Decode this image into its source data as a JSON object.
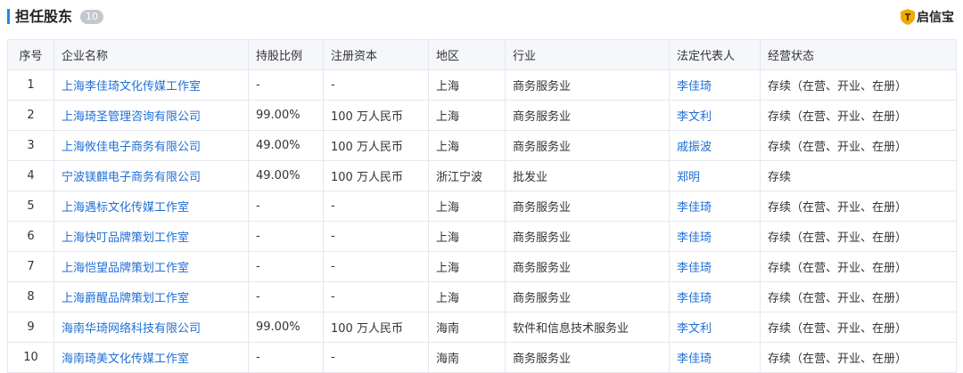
{
  "header": {
    "title": "担任股东",
    "count": "10",
    "brand": "启信宝"
  },
  "table": {
    "columns": [
      "序号",
      "企业名称",
      "持股比例",
      "注册资本",
      "地区",
      "行业",
      "法定代表人",
      "经营状态"
    ],
    "rows": [
      {
        "idx": "1",
        "name": "上海李佳琦文化传媒工作室",
        "ratio": "-",
        "capital": "-",
        "region": "上海",
        "industry": "商务服务业",
        "rep": "李佳琦",
        "status": "存续（在营、开业、在册）"
      },
      {
        "idx": "2",
        "name": "上海琦圣管理咨询有限公司",
        "ratio": "99.00%",
        "capital": "100 万人民币",
        "region": "上海",
        "industry": "商务服务业",
        "rep": "李文利",
        "status": "存续（在营、开业、在册）"
      },
      {
        "idx": "3",
        "name": "上海攸佳电子商务有限公司",
        "ratio": "49.00%",
        "capital": "100 万人民币",
        "region": "上海",
        "industry": "商务服务业",
        "rep": "戚振波",
        "status": "存续（在营、开业、在册）"
      },
      {
        "idx": "4",
        "name": "宁波镁麒电子商务有限公司",
        "ratio": "49.00%",
        "capital": "100 万人民币",
        "region": "浙江宁波",
        "industry": "批发业",
        "rep": "郑明",
        "status": "存续"
      },
      {
        "idx": "5",
        "name": "上海遇标文化传媒工作室",
        "ratio": "-",
        "capital": "-",
        "region": "上海",
        "industry": "商务服务业",
        "rep": "李佳琦",
        "status": "存续（在营、开业、在册）"
      },
      {
        "idx": "6",
        "name": "上海快叮品牌策划工作室",
        "ratio": "-",
        "capital": "-",
        "region": "上海",
        "industry": "商务服务业",
        "rep": "李佳琦",
        "status": "存续（在营、开业、在册）"
      },
      {
        "idx": "7",
        "name": "上海恺望品牌策划工作室",
        "ratio": "-",
        "capital": "-",
        "region": "上海",
        "industry": "商务服务业",
        "rep": "李佳琦",
        "status": "存续（在营、开业、在册）"
      },
      {
        "idx": "8",
        "name": "上海爵醒品牌策划工作室",
        "ratio": "-",
        "capital": "-",
        "region": "上海",
        "industry": "商务服务业",
        "rep": "李佳琦",
        "status": "存续（在营、开业、在册）"
      },
      {
        "idx": "9",
        "name": "海南华琦网络科技有限公司",
        "ratio": "99.00%",
        "capital": "100 万人民币",
        "region": "海南",
        "industry": "软件和信息技术服务业",
        "rep": "李文利",
        "status": "存续（在营、开业、在册）"
      },
      {
        "idx": "10",
        "name": "海南琦美文化传媒工作室",
        "ratio": "-",
        "capital": "-",
        "region": "海南",
        "industry": "商务服务业",
        "rep": "李佳琦",
        "status": "存续（在营、开业、在册）"
      }
    ]
  },
  "colors": {
    "accent": "#1e87f0",
    "link": "#1f6fd6",
    "badge": "#c3c7ce",
    "brand_shield": "#f2a900"
  },
  "icons": {
    "brand": "shield-logo-icon"
  }
}
